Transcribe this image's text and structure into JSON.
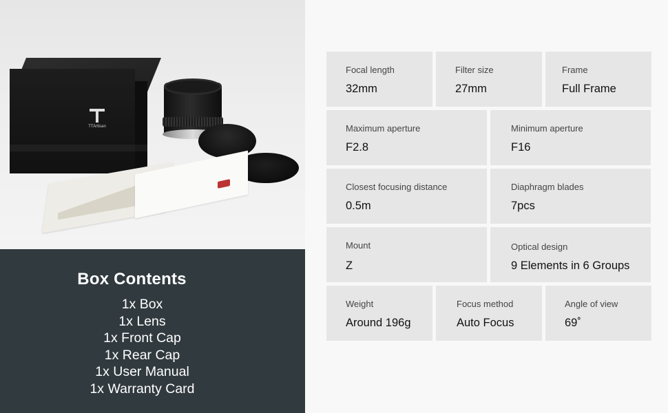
{
  "photo": {
    "box_brand": "TTArtisan"
  },
  "box_contents": {
    "title": "Box Contents",
    "items": [
      "1x Box",
      "1x Lens",
      "1x Front Cap",
      "1x Rear Cap",
      "1x User Manual",
      "1x Warranty Card"
    ]
  },
  "specs": {
    "focal_length": {
      "label": "Focal length",
      "value": "32mm"
    },
    "filter_size": {
      "label": "Filter size",
      "value": "27mm"
    },
    "frame": {
      "label": "Frame",
      "value": "Full Frame"
    },
    "max_aperture": {
      "label": "Maximum aperture",
      "value": "F2.8"
    },
    "min_aperture": {
      "label": "Minimum aperture",
      "value": "F16"
    },
    "closest_focus": {
      "label": "Closest focusing distance",
      "value": "0.5m"
    },
    "diaphragm": {
      "label": "Diaphragm blades",
      "value": "7pcs"
    },
    "mount": {
      "label": "Mount",
      "value": "Z"
    },
    "optical_design": {
      "label": "Optical design",
      "value": "9 Elements in 6 Groups"
    },
    "weight": {
      "label": "Weight",
      "value": "Around 196g"
    },
    "focus_method": {
      "label": "Focus method",
      "value": "Auto Focus"
    },
    "angle_of_view": {
      "label": "Angle of view",
      "value": "69˚"
    }
  },
  "colors": {
    "panel": "#313a3f",
    "cell": "#e6e6e6",
    "background": "#f8f8f8"
  }
}
